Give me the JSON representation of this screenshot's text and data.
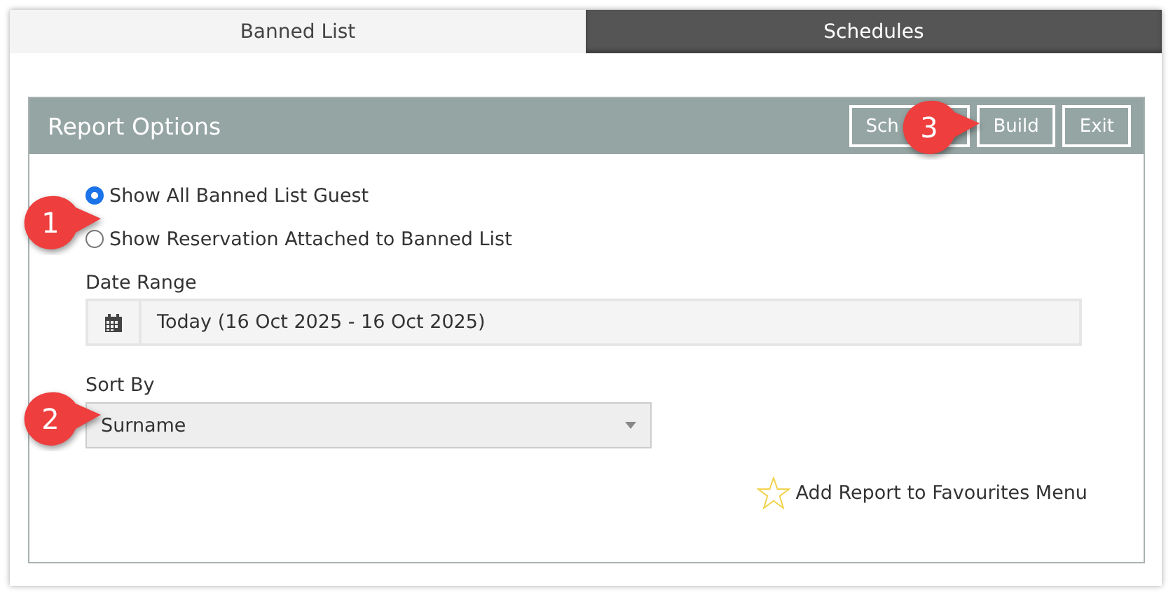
{
  "tabs": [
    {
      "label": "Banned List",
      "selected": true
    },
    {
      "label": "Schedules",
      "selected": false
    }
  ],
  "panel": {
    "title": "Report Options",
    "buttons": [
      "Sch",
      "Build",
      "Exit"
    ]
  },
  "options": [
    {
      "label": "Show All Banned List Guest",
      "selected": true
    },
    {
      "label": "Show Reservation Attached to Banned List",
      "selected": false
    }
  ],
  "date_range": {
    "label": "Date Range",
    "value": "Today (16 Oct 2025 - 16 Oct 2025)"
  },
  "sort_by": {
    "label": "Sort By",
    "value": "Surname"
  },
  "favourites": {
    "label": "Add Report to Favourites Menu"
  },
  "callouts": [
    "1",
    "2",
    "3"
  ]
}
